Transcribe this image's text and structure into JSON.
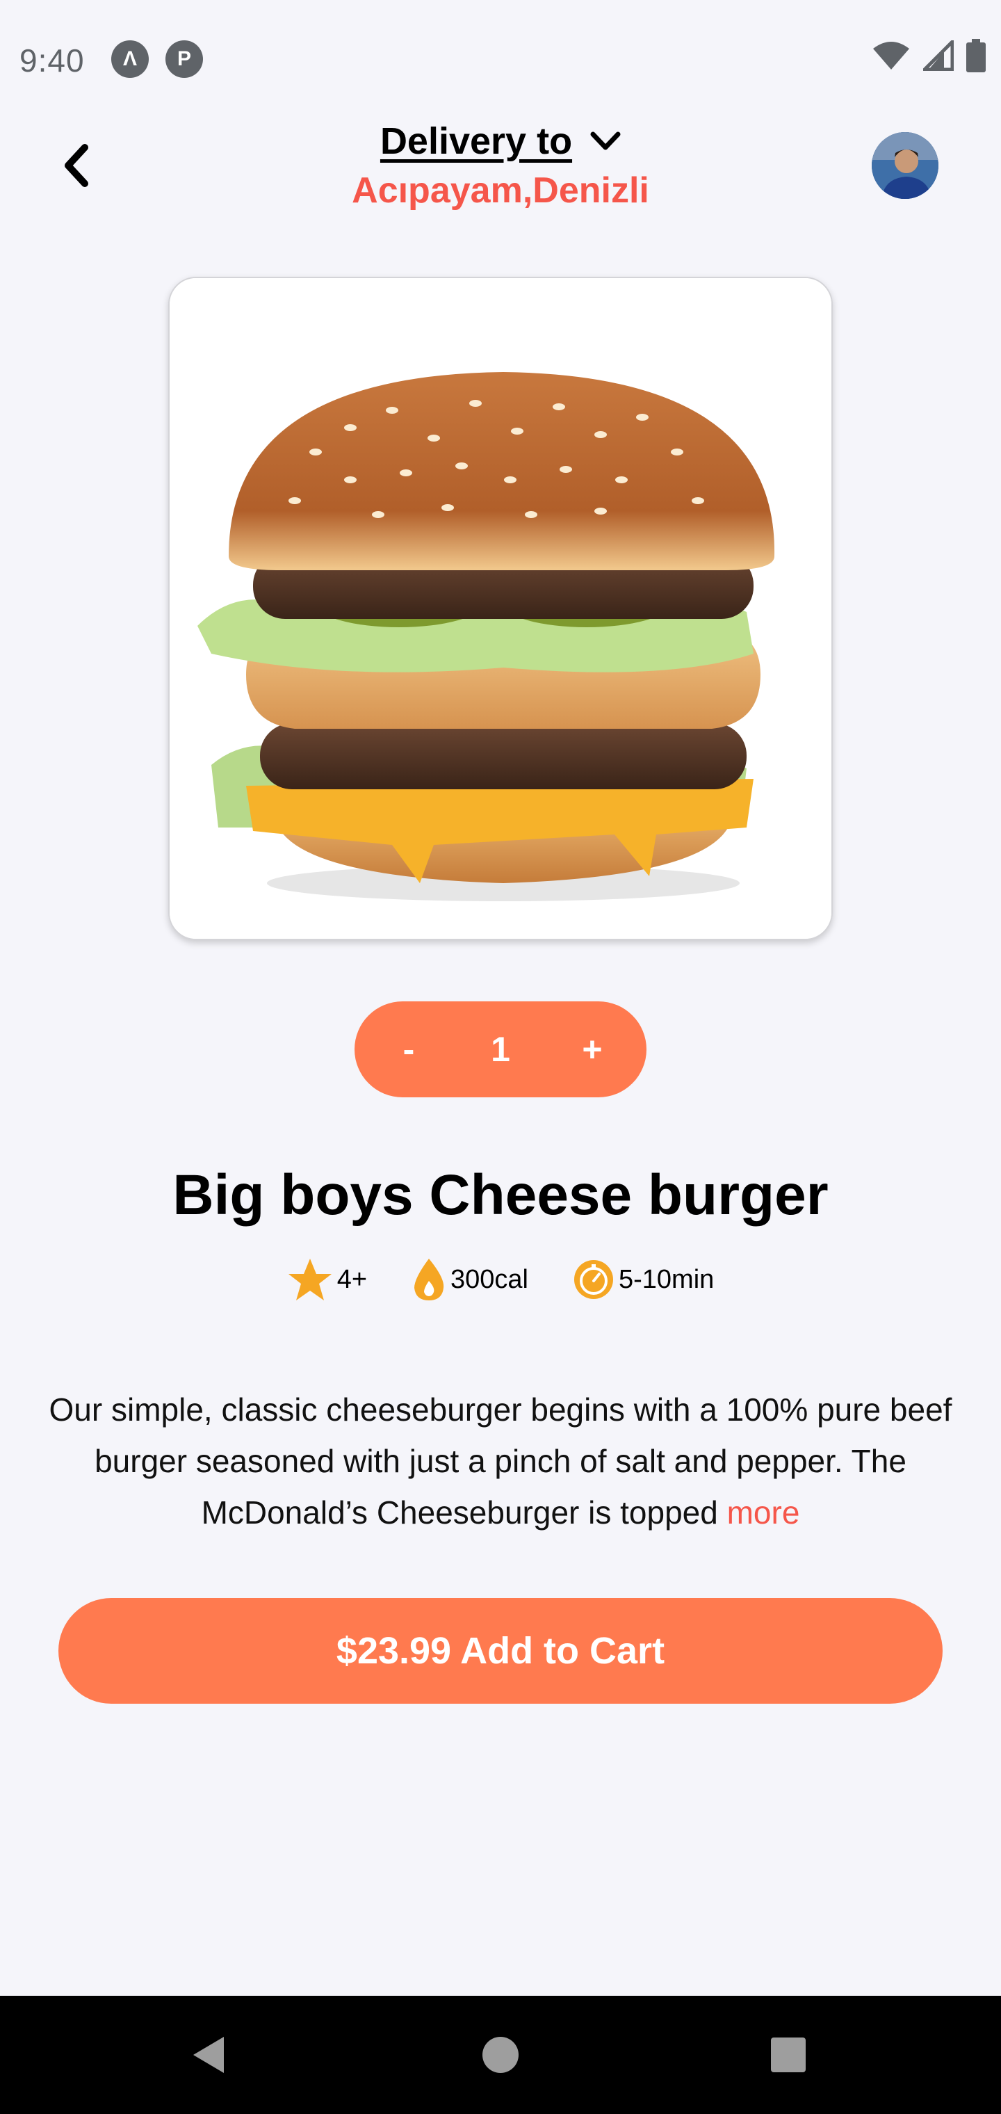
{
  "status_bar": {
    "time": "9:40",
    "app_icon_1": "Λ",
    "app_icon_2": "P",
    "icons": [
      "wifi-icon",
      "signal-icon",
      "battery-icon"
    ]
  },
  "header": {
    "back_icon": "chevron-left-icon",
    "delivery_label": "Delivery to",
    "delivery_location": "Acıpayam,Denizli",
    "dropdown_icon": "chevron-down-icon",
    "avatar": "user-avatar"
  },
  "product": {
    "image": "cheeseburger-image",
    "quantity": {
      "minus_label": "-",
      "value": "1",
      "plus_label": "+"
    },
    "title": "Big boys Cheese burger",
    "meta": {
      "rating": "4+",
      "calories": "300cal",
      "time": "5-10min"
    },
    "description": "Our simple, classic cheeseburger begins with a 100% pure beef burger seasoned with just a pinch of salt and pepper. The McDonald’s Cheeseburger is topped",
    "more_label": "more"
  },
  "cart": {
    "button_label": "$23.99 Add to Cart"
  },
  "colors": {
    "accent": "#ff7a4f",
    "location_red": "#f5564a",
    "star": "#f5a623",
    "background": "#f5f5fa"
  }
}
